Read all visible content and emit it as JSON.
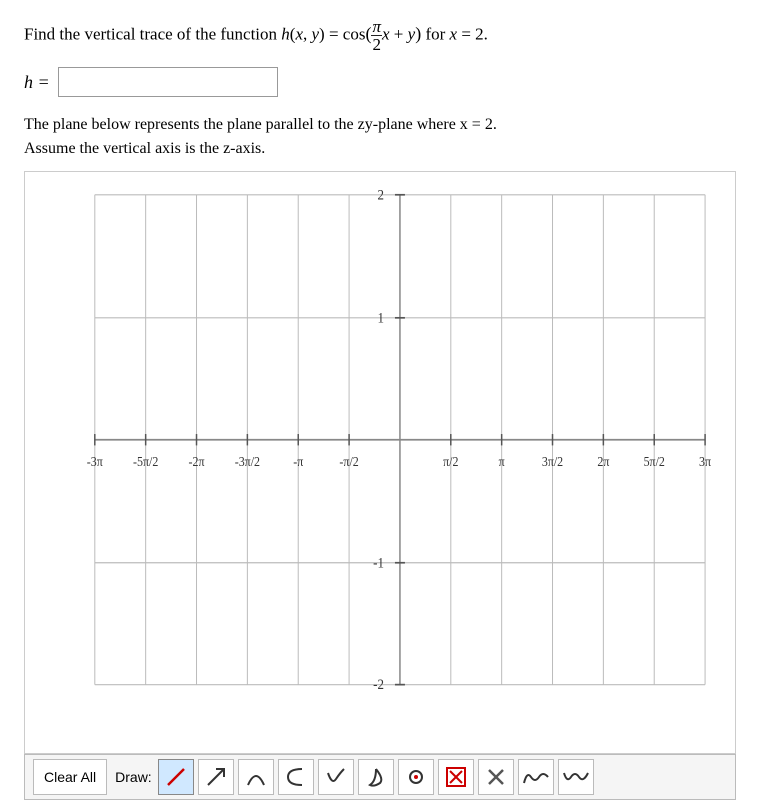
{
  "problem": {
    "intro": "Find the vertical trace of the function",
    "function_label": "h(x, y)",
    "equals": "=",
    "formula": "cos(π/2 · x + y)",
    "condition": "for x = 2.",
    "answer_label": "h =",
    "description_line1": "The plane below represents the plane parallel to the zy-plane where x = 2.",
    "description_line2": "Assume the vertical axis is the z-axis."
  },
  "toolbar": {
    "clear_all": "Clear All",
    "draw_label": "Draw:",
    "tools": [
      {
        "id": "draw-slash",
        "symbol": "/",
        "active": true
      },
      {
        "id": "draw-arrow",
        "symbol": "↗",
        "active": false
      },
      {
        "id": "draw-arch",
        "symbol": "∩",
        "active": false
      },
      {
        "id": "draw-curve-left",
        "symbol": "C",
        "active": false
      },
      {
        "id": "draw-check",
        "symbol": "✓",
        "active": false
      },
      {
        "id": "draw-swoop",
        "symbol": "∫",
        "active": false
      },
      {
        "id": "draw-circle",
        "symbol": "○",
        "active": false
      },
      {
        "id": "draw-x-box",
        "symbol": "⊠",
        "active": false
      },
      {
        "id": "draw-x2",
        "symbol": "✕",
        "active": false
      },
      {
        "id": "draw-wave1",
        "symbol": "m",
        "active": false
      },
      {
        "id": "draw-wave2",
        "symbol": "w",
        "active": false
      }
    ]
  },
  "graph": {
    "x_labels": [
      "-3π",
      "-5π/2",
      "-2π",
      "-3π/2",
      "-π",
      "-π/2",
      "π/2",
      "π",
      "3π/2",
      "2π",
      "5π/2",
      "3π"
    ],
    "y_labels": [
      "2",
      "1",
      "-1",
      "-2"
    ]
  },
  "colors": {
    "grid": "#c0c0c0",
    "axis": "#555",
    "text": "#222",
    "active_tool": "#d0e8ff"
  }
}
